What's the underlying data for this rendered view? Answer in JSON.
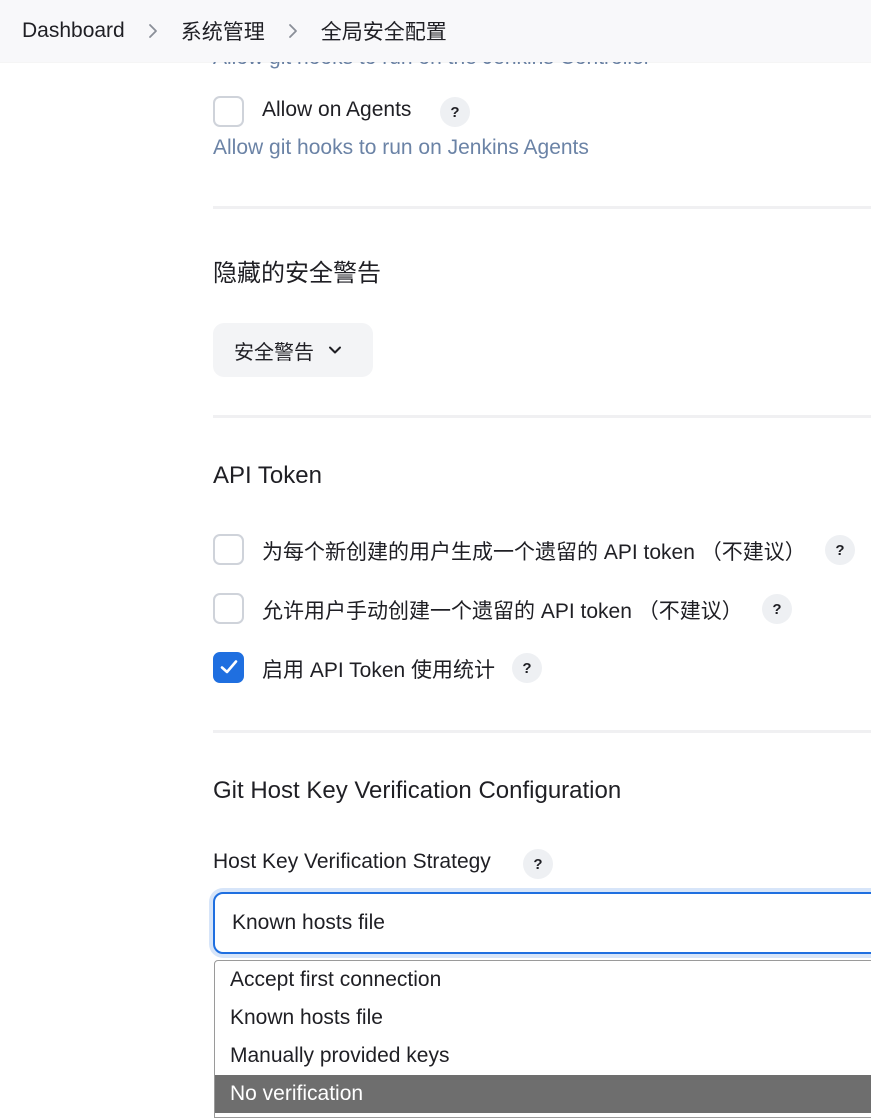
{
  "breadcrumb": {
    "items": [
      "Dashboard",
      "系统管理",
      "全局安全配置"
    ]
  },
  "git_hooks": {
    "controller_desc": "Allow git hooks to run on the Jenkins Controller",
    "agents_label": "Allow on Agents",
    "agents_desc": "Allow git hooks to run on Jenkins Agents",
    "agents_checked": false
  },
  "hidden_warnings": {
    "title": "隐藏的安全警告",
    "button_label": "安全警告"
  },
  "api_token": {
    "title": "API Token",
    "options": [
      {
        "label": "为每个新创建的用户生成一个遗留的 API token （不建议）",
        "checked": false
      },
      {
        "label": "允许用户手动创建一个遗留的 API token （不建议）",
        "checked": false
      },
      {
        "label": "启用 API Token 使用统计",
        "checked": true
      }
    ]
  },
  "git_host_key": {
    "title": "Git Host Key Verification Configuration",
    "strategy_label": "Host Key Verification Strategy",
    "selected_value": "Known hosts file",
    "options": [
      "Accept first connection",
      "Known hosts file",
      "Manually provided keys",
      "No verification"
    ],
    "highlighted_option": "No verification"
  },
  "help_text": "?",
  "colors": {
    "accent": "#1f6fe0",
    "description_text": "#6b83a6",
    "highlight_option": "#6e6e6e"
  }
}
